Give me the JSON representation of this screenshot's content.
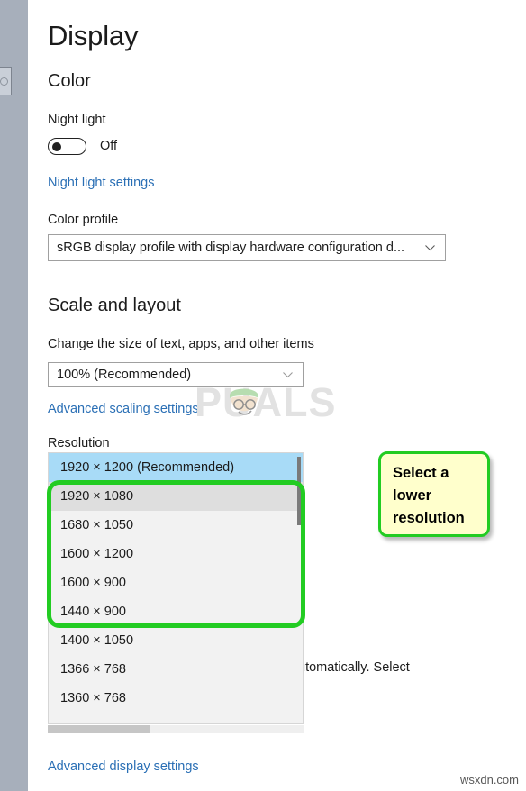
{
  "page": {
    "title": "Display",
    "site_watermark": "wsxdn.com",
    "brand_watermark": "PUALS"
  },
  "color_section": {
    "heading": "Color",
    "night_light_label": "Night light",
    "night_light_state": "Off",
    "night_light_settings_link": "Night light settings",
    "color_profile_label": "Color profile",
    "color_profile_value": "sRGB display profile with display hardware configuration d..."
  },
  "scale_section": {
    "heading": "Scale and layout",
    "scale_label": "Change the size of text, apps, and other items",
    "scale_value": "100% (Recommended)",
    "advanced_scaling_link": "Advanced scaling settings",
    "resolution_label": "Resolution",
    "helper_text_fragment": "utomatically. Select"
  },
  "resolution_dropdown": {
    "selected_value": "1920 × 1200 (Recommended)",
    "hovered_value": "1920 × 1080",
    "options": [
      "1920 × 1200 (Recommended)",
      "1920 × 1080",
      "1680 × 1050",
      "1600 × 1200",
      "1600 × 900",
      "1440 × 900",
      "1400 × 1050",
      "1366 × 768",
      "1360 × 768"
    ]
  },
  "annotation": {
    "callout_text": "Select a lower resolution",
    "highlight_color": "#22cc22",
    "callout_background": "#ffffcc"
  },
  "footer": {
    "advanced_display_settings_link": "Advanced display settings"
  },
  "colors": {
    "accent_link": "#2a6fb5",
    "selected_row": "#a8dbf7",
    "sidebar": "#a7afbb"
  }
}
